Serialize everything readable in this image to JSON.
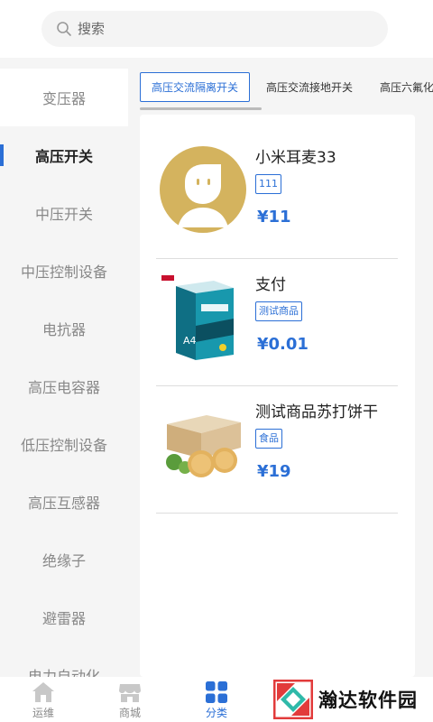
{
  "search": {
    "placeholder": "搜索"
  },
  "sidebar": {
    "items": [
      {
        "label": "变压器"
      },
      {
        "label": "高压开关"
      },
      {
        "label": "中压开关"
      },
      {
        "label": "中压控制设备"
      },
      {
        "label": "电抗器"
      },
      {
        "label": "高压电容器"
      },
      {
        "label": "低压控制设备"
      },
      {
        "label": "高压互感器"
      },
      {
        "label": "绝缘子"
      },
      {
        "label": "避雷器"
      },
      {
        "label": "电力自动化"
      }
    ],
    "active_index": 1
  },
  "tabs": [
    {
      "label": "高压交流隔离开关"
    },
    {
      "label": "高压交流接地开关"
    },
    {
      "label": "高压六氟化"
    }
  ],
  "products": [
    {
      "name": "小米耳麦33",
      "tag": "111",
      "price": "¥11"
    },
    {
      "name": "支付",
      "tag": "测试商品",
      "price": "¥0.01"
    },
    {
      "name": "测试商品苏打饼干",
      "tag": "食品",
      "price": "¥19"
    }
  ],
  "bottom_nav": {
    "items": [
      {
        "label": "运维",
        "icon": "home-icon"
      },
      {
        "label": "商城",
        "icon": "shop-icon"
      },
      {
        "label": "分类",
        "icon": "category-icon"
      }
    ],
    "active_index": 2
  },
  "watermark": {
    "text": "瀚达软件园"
  },
  "colors": {
    "accent": "#2b6fd6",
    "avatar": "#d4b35e"
  }
}
